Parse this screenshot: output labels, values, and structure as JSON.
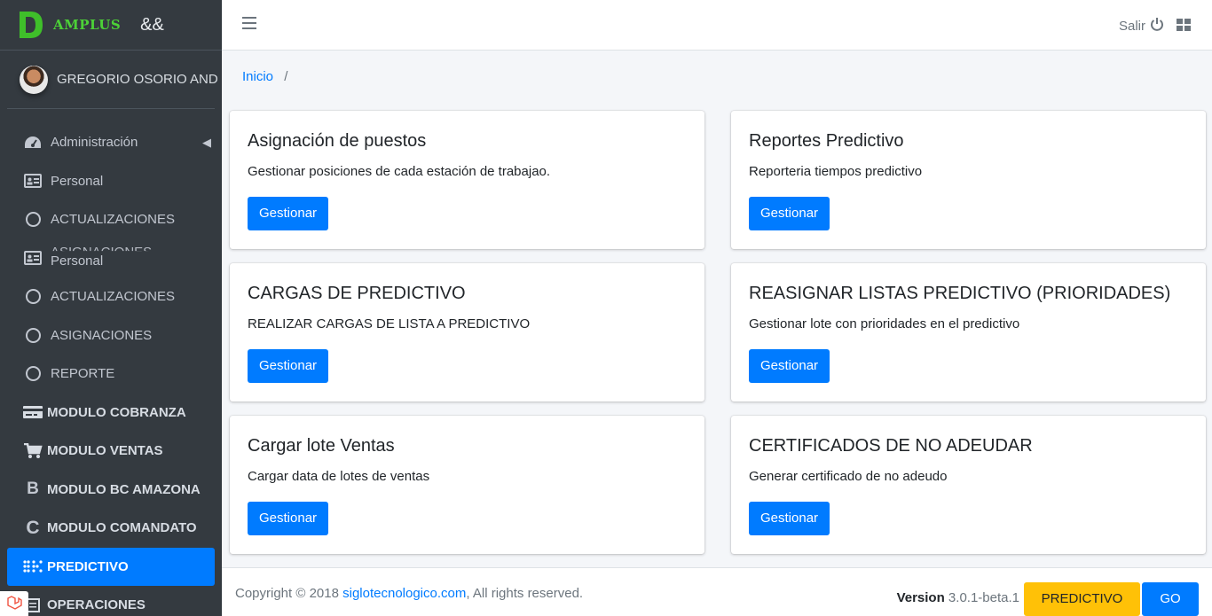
{
  "brand": {
    "name": "AMPLUS",
    "extra": "&&"
  },
  "user": {
    "name": "GREGORIO OSORIO AND"
  },
  "sidebar": {
    "items": [
      {
        "label": "Administración",
        "icon": "tachometer-icon"
      },
      {
        "label": "Personal",
        "icon": "id-card-icon"
      },
      {
        "label": "ACTUALIZACIONES",
        "icon": "circle-icon"
      },
      {
        "label": "Personal",
        "ghost": "ASIGNACIONES",
        "icon": "id-card-icon"
      },
      {
        "label": "ACTUALIZACIONES",
        "icon": "circle-icon"
      },
      {
        "label": "ASIGNACIONES",
        "icon": "circle-icon"
      },
      {
        "label": "REPORTE",
        "icon": "circle-icon"
      },
      {
        "label": "MODULO COBRANZA",
        "icon": "money-icon"
      },
      {
        "label": "MODULO VENTAS",
        "icon": "cart-icon"
      },
      {
        "label": "MODULO BC AMAZONA",
        "icon": "bitcoin-icon"
      },
      {
        "label": "MODULO COMANDATO",
        "icon": "c-icon"
      },
      {
        "label": "PREDICTIVO",
        "icon": "braille-icon"
      },
      {
        "label": "OPERACIONES",
        "icon": "list-icon"
      }
    ]
  },
  "header": {
    "salir": "Salir"
  },
  "breadcrumb": {
    "home": "Inicio",
    "sep": "/"
  },
  "cards": [
    {
      "title": "Asignación de puestos",
      "text": "Gestionar posiciones de cada estación de trabajao.",
      "button": "Gestionar"
    },
    {
      "title": "Reportes Predictivo",
      "text": "Reporteria tiempos predictivo",
      "button": "Gestionar"
    },
    {
      "title": "CARGAS DE PREDICTIVO",
      "text": "REALIZAR CARGAS DE LISTA A PREDICTIVO",
      "button": "Gestionar"
    },
    {
      "title": "REASIGNAR LISTAS PREDICTIVO (PRIORIDADES)",
      "text": "Gestionar lote con prioridades en el predictivo",
      "button": "Gestionar"
    },
    {
      "title": "Cargar lote Ventas",
      "text": "Cargar data de lotes de ventas",
      "button": "Gestionar"
    },
    {
      "title": "CERTIFICADOS DE NO ADEUDAR",
      "text": "Generar certificado de no adeudo",
      "button": "Gestionar"
    }
  ],
  "footer": {
    "copy_prefix": "Copyright © 2018 ",
    "link": "siglotecnologico.com",
    "copy_suffix": ", All rights reserved.",
    "version_label": "Version",
    "version_value": " 3.0.1-beta.1",
    "predictivo_button": "PREDICTIVO",
    "go_button": "GO"
  },
  "colors": {
    "primary": "#007bff",
    "warning": "#ffc107",
    "sidebar": "#343a40",
    "brand": "#4cd137"
  }
}
